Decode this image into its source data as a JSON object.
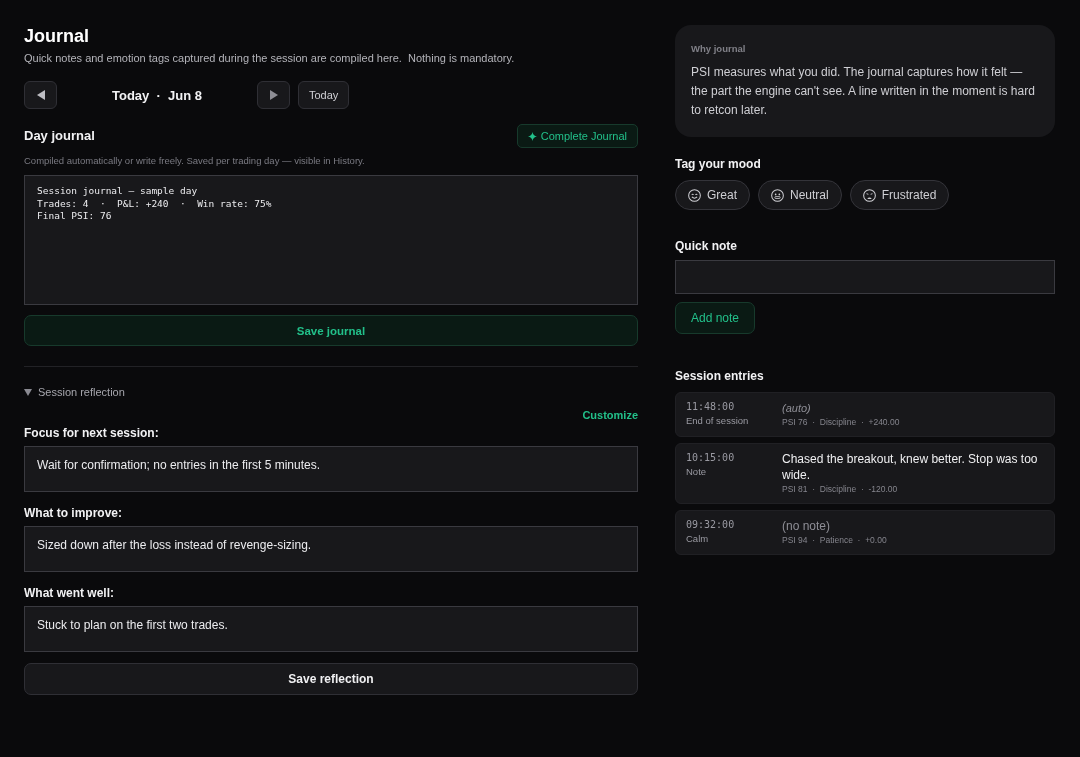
{
  "header": {
    "title": "Journal",
    "subtitle": "Quick notes and emotion tags captured during the session are compiled here.  Nothing is mandatory.",
    "date_nav": {
      "label": "Today  ·  Jun 8",
      "today_button": "Today"
    }
  },
  "day_journal": {
    "title": "Day journal",
    "complete_button": "Complete Journal",
    "hint": "Compiled automatically or write freely. Saved per trading day — visible in History.",
    "text": "Session journal — sample day\nTrades: 4  ·  P&L: +240  ·  Win rate: 75%\nFinal PSI: 76",
    "save_button": "Save journal"
  },
  "reflection": {
    "title": "Session reflection",
    "expanded": true,
    "customize_link": "Customize",
    "fields": [
      {
        "label": "Focus for next session:",
        "value": "Wait for confirmation; no entries in the first 5 minutes."
      },
      {
        "label": "What to improve:",
        "value": "Sized down after the loss instead of revenge-sizing."
      },
      {
        "label": "What went well:",
        "value": "Stuck to plan on the first two trades."
      }
    ],
    "save_button": "Save reflection"
  },
  "why_card": {
    "title": "Why journal",
    "text": "PSI measures what you did. The journal captures how it felt — the part the engine can't see. A line written in the moment is hard to retcon later."
  },
  "mood": {
    "title": "Tag your mood",
    "tags": [
      {
        "kind": "happy",
        "label": "Great",
        "selected": false
      },
      {
        "kind": "neutral",
        "label": "Neutral",
        "selected": false
      },
      {
        "kind": "upset",
        "label": "Frustrated",
        "selected": false
      }
    ]
  },
  "quick_note": {
    "label": "Quick note",
    "button": "Add note"
  },
  "session_entries": {
    "title": "Session entries",
    "entries": [
      {
        "time": "11:48:00",
        "source": "End of session",
        "kind": "auto",
        "note": "(auto)",
        "meta": "PSI 76  ·  Discipline  ·  +240.00"
      },
      {
        "time": "10:15:00",
        "source": "Note",
        "kind": "note",
        "note": "Chased the breakout, knew better. Stop was too wide.",
        "meta": "PSI 81  ·  Discipline  ·  -120.00"
      },
      {
        "time": "09:32:00",
        "source": "Calm",
        "kind": "empty",
        "note": "(no note)",
        "meta": "PSI 94  ·  Patience  ·  +0.00"
      }
    ]
  }
}
